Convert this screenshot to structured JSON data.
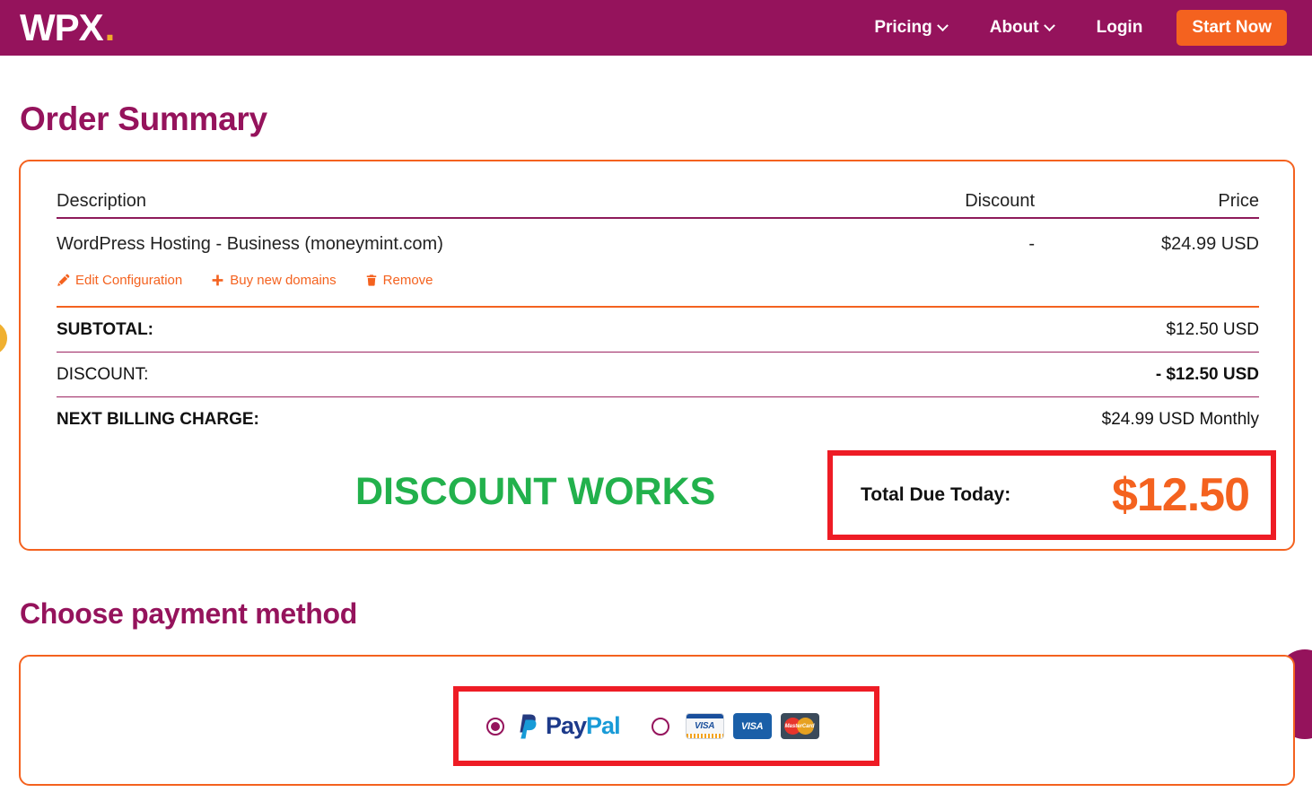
{
  "header": {
    "logo_text": "WPX",
    "logo_dot": ".",
    "nav": [
      {
        "label": "Pricing",
        "icon": "chevron-down-icon",
        "has_chevron": true
      },
      {
        "label": "About",
        "icon": "chevron-down-icon",
        "has_chevron": true
      },
      {
        "label": "Login",
        "has_chevron": false
      }
    ],
    "cta_label": "Start Now",
    "brand_color": "#95135c",
    "accent_color": "#f4621f",
    "logo_dot_color": "#f0ac2a"
  },
  "order_summary": {
    "heading": "Order Summary",
    "columns": {
      "description": "Description",
      "discount": "Discount",
      "price": "Price"
    },
    "items": [
      {
        "description": "WordPress Hosting - Business (moneymint.com)",
        "discount": "-",
        "price": "$24.99 USD",
        "actions": [
          {
            "label": "Edit Configuration",
            "icon": "pencil-icon"
          },
          {
            "label": "Buy new domains",
            "icon": "plus-icon"
          },
          {
            "label": "Remove",
            "icon": "trash-icon"
          }
        ]
      }
    ],
    "totals": [
      {
        "label": "SUBTOTAL:",
        "value": "$12.50 USD",
        "label_bold": true,
        "value_bold": false
      },
      {
        "label": "DISCOUNT:",
        "value": "- $12.50 USD",
        "label_bold": false,
        "value_bold": true
      },
      {
        "label": "NEXT BILLING CHARGE:",
        "value": "$24.99 USD Monthly",
        "label_bold": true,
        "value_bold": false
      }
    ],
    "total_due": {
      "label": "Total Due Today:",
      "amount": "$12.50",
      "amount_color": "#f4621f",
      "highlight_color": "#ee1c25"
    },
    "annotation": {
      "text": "DISCOUNT WORKS",
      "color": "#22b14c"
    }
  },
  "payment": {
    "heading": "Choose payment method",
    "highlight_color": "#ee1c25",
    "options": [
      {
        "id": "paypal",
        "selected": true,
        "logo": "paypal-logo",
        "label_part1": "Pay",
        "label_part2": "Pal"
      },
      {
        "id": "credit-card",
        "selected": false,
        "logo": "card-logos",
        "cards": [
          "visa-light",
          "visa-solid",
          "mastercard"
        ],
        "card_labels": [
          "VISA",
          "VISA",
          "MasterCard"
        ]
      }
    ]
  }
}
